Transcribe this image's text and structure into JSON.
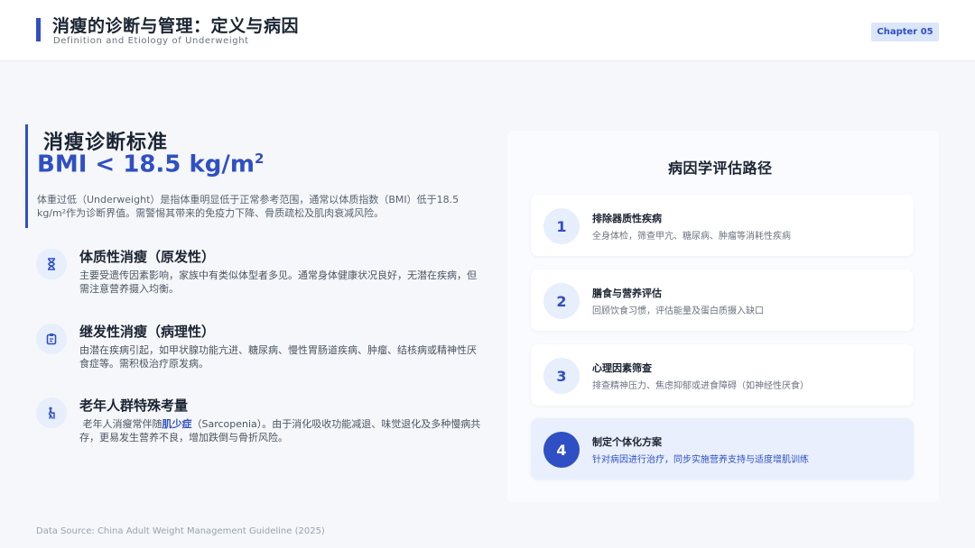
{
  "header": {
    "title": "消瘦的诊断与管理：定义与病因",
    "subtitle": "Definition and Etiology of Underweight",
    "chapter": "Chapter 05"
  },
  "criteria": {
    "title": "消瘦诊断标准",
    "bmi": "BMI < 18.5 kg/m",
    "bmi_sup": "2",
    "description": "体重过低（Underweight）是指体重明显低于正常参考范围，通常以体质指数（BMI）低于18.5 kg/m²作为诊断界值。需警惕其带来的免疫力下降、骨质疏松及肌肉衰减风险。"
  },
  "types": [
    {
      "icon": "hourglass-icon",
      "title": "体质性消瘦（原发性）",
      "desc": "主要受遗传因素影响，家族中有类似体型者多见。通常身体健康状况良好，无潜在疾病，但需注意营养摄入均衡。"
    },
    {
      "icon": "clipboard-icon",
      "title": "继发性消瘦（病理性）",
      "desc": "由潜在疾病引起，如甲状腺功能亢进、糖尿病、慢性胃肠道疾病、肿瘤、结核病或精神性厌食症等。需积极治疗原发病。"
    },
    {
      "icon": "elderly-person-icon",
      "title": "老年人群特殊考量",
      "desc_pre": "老年人消瘦常伴随",
      "desc_highlight": "肌少症",
      "desc_post": "（Sarcopenia）。由于消化吸收功能减退、味觉退化及多种慢病共存，更易发生营养不良，增加跌倒与骨折风险。"
    }
  ],
  "pathway": {
    "title": "病因学评估路径",
    "steps": [
      {
        "num": "1",
        "title": "排除器质性疾病",
        "desc": "全身体检，筛查甲亢、糖尿病、肿瘤等消耗性疾病"
      },
      {
        "num": "2",
        "title": "膳食与营养评估",
        "desc": "回顾饮食习惯，评估能量及蛋白质摄入缺口"
      },
      {
        "num": "3",
        "title": "心理因素筛查",
        "desc": "排查精神压力、焦虑抑郁或进食障碍（如神经性厌食）"
      },
      {
        "num": "4",
        "title": "制定个体化方案",
        "desc": "针对病因进行治疗，同步实施营养支持与适度增肌训练"
      }
    ]
  },
  "footer": "Data Source: China Adult Weight Management Guideline (2025)",
  "colors": {
    "accent": "#2f4fc4",
    "accent_light": "#e7eefc"
  }
}
